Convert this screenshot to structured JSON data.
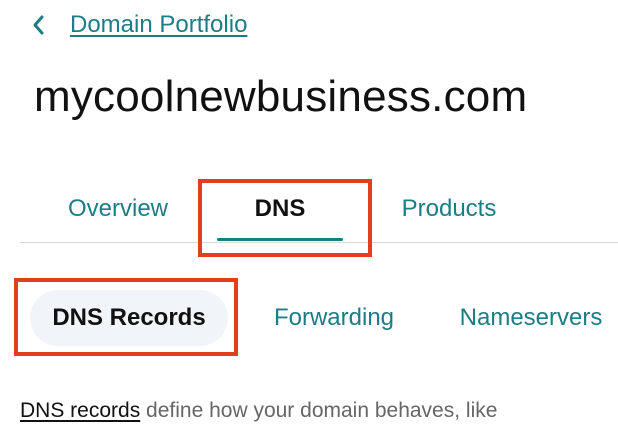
{
  "breadcrumb": {
    "back_icon": "chevron-left-icon",
    "label": "Domain Portfolio"
  },
  "page": {
    "title": "mycoolnewbusiness.com"
  },
  "tabs": [
    {
      "label": "Overview",
      "active": false
    },
    {
      "label": "DNS",
      "active": true
    },
    {
      "label": "Products",
      "active": false
    }
  ],
  "subtabs": [
    {
      "label": "DNS Records",
      "active": true
    },
    {
      "label": "Forwarding",
      "active": false
    },
    {
      "label": "Nameservers",
      "active": false
    }
  ],
  "description": {
    "link": "DNS records",
    "text": " define how your domain behaves, like"
  },
  "colors": {
    "accent": "#1b7d86",
    "highlight": "#e43f1d",
    "active_pill": "#f1f5fa"
  }
}
